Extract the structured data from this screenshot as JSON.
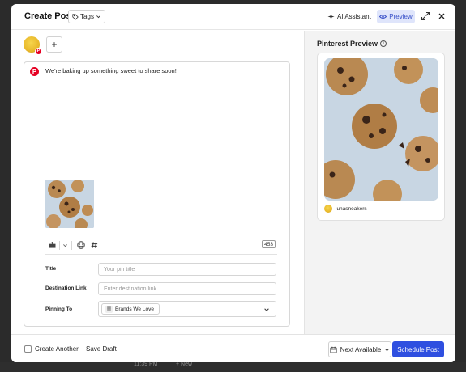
{
  "header": {
    "title": "Create Post",
    "tags_label": "Tags",
    "ai_label": "AI Assistant",
    "preview_label": "Preview"
  },
  "composer": {
    "post_text": "We're baking up something sweet to share soon!",
    "char_count": "453",
    "fields": {
      "title_label": "Title",
      "title_placeholder": "Your pin title",
      "link_label": "Destination Link",
      "link_placeholder": "Enter destination link...",
      "pinning_label": "Pinning To",
      "board": "Brands We Love"
    }
  },
  "preview": {
    "title": "Pinterest Preview",
    "username": "lunasneakers"
  },
  "footer": {
    "create_another": "Create Another",
    "save_draft": "Save Draft",
    "next_available": "Next Available",
    "schedule": "Schedule Post"
  },
  "background": {
    "time": "11:39 PM",
    "new_label": "+ New"
  },
  "colors": {
    "accent": "#2f4fe0",
    "preview_active_bg": "#dfe5fb",
    "pinterest_red": "#e60023"
  },
  "icons": {
    "tags": "tag-icon",
    "ai": "sparkle-icon",
    "preview": "eye-icon",
    "expand": "expand-icon",
    "close": "close-icon",
    "media": "image-icon",
    "emoji": "emoji-icon",
    "hashtag": "hashtag-icon",
    "calendar": "calendar-icon"
  }
}
